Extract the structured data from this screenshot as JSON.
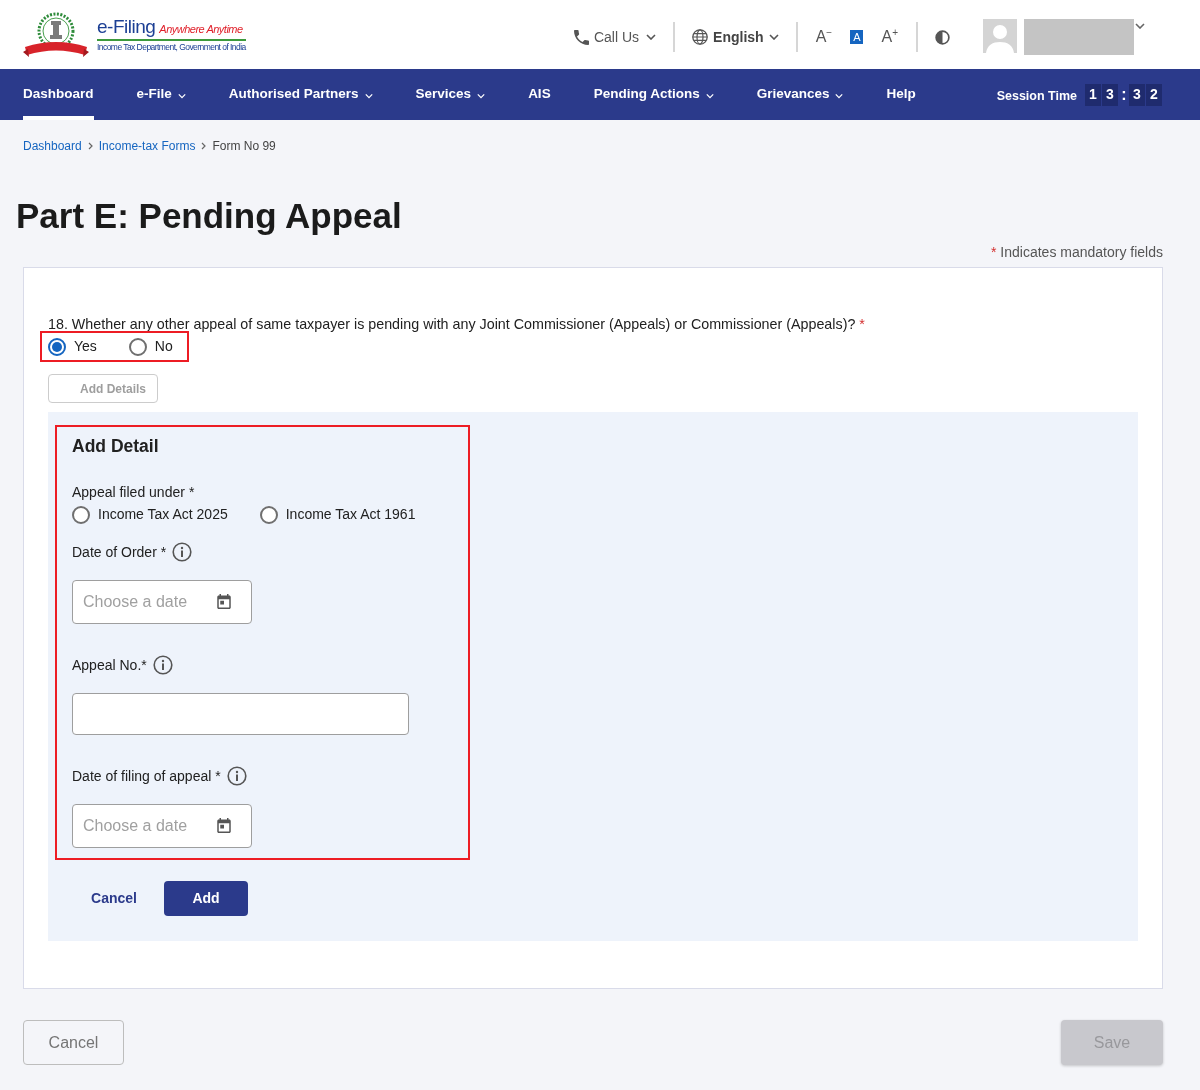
{
  "header": {
    "logo": {
      "title": "e-Filing",
      "tagline": "Anywhere Anytime",
      "subtitle": "Income Tax Department, Government of India"
    },
    "call_us": {
      "label": "Call Us"
    },
    "language": {
      "label": "English"
    },
    "text_size": [
      {
        "label": "A$^{−}$",
        "selected": false
      },
      {
        "label": "A",
        "selected": true
      },
      {
        "label": "A$^{+}$",
        "selected": false
      }
    ]
  },
  "nav": {
    "items": [
      {
        "label": "Dashboard",
        "selected": true,
        "dropdown": false
      },
      {
        "label": "e-File",
        "selected": false,
        "dropdown": true
      },
      {
        "label": "Authorised Partners",
        "selected": false,
        "dropdown": true
      },
      {
        "label": "Services",
        "selected": false,
        "dropdown": true
      },
      {
        "label": "AIS",
        "selected": false,
        "dropdown": false
      },
      {
        "label": "Pending Actions",
        "selected": false,
        "dropdown": true
      },
      {
        "label": "Grievances",
        "selected": false,
        "dropdown": true
      },
      {
        "label": "Help",
        "selected": false,
        "dropdown": false
      }
    ],
    "session_time": {
      "label": "Session Time",
      "minutes": [
        "1",
        "3"
      ],
      "separator": ":",
      "seconds": [
        "3",
        "2"
      ]
    }
  },
  "breadcrumb": [
    {
      "label": "Dashboard",
      "link": true
    },
    {
      "label": "Income-tax Forms",
      "link": true
    },
    {
      "label": "Form No 99",
      "link": false
    }
  ],
  "page_title": "Part E: Pending Appeal",
  "mandatory_note": {
    "mark": "*",
    "text": "Indicates mandatory fields"
  },
  "question": {
    "text": "18. Whether any other appeal of same taxpayer is pending with any Joint Commissioner (Appeals) or Commissioner (Appeals)?",
    "required_mark": "*",
    "highlighted": true,
    "options": [
      {
        "label": "Yes",
        "selected": true
      },
      {
        "label": "No",
        "selected": false
      }
    ]
  },
  "add_details_button": {
    "label": "Add Details",
    "disabled": true
  },
  "detail_panel": {
    "title": "Add Detail",
    "highlighted": true,
    "fields": [
      {
        "kind": "radio",
        "label": "Appeal filed under",
        "required_mark": "*",
        "info": false,
        "options": [
          {
            "label": "Income Tax Act 2025",
            "selected": false
          },
          {
            "label": "Income Tax Act 1961",
            "selected": false
          }
        ]
      },
      {
        "kind": "date",
        "label": "Date of Order",
        "required_mark": "*",
        "info": true,
        "placeholder": "Choose a date"
      },
      {
        "kind": "text",
        "label": "Appeal No.",
        "required_mark": "*",
        "info": true
      },
      {
        "kind": "date",
        "label": "Date of filing of appeal",
        "required_mark": "*",
        "info": true,
        "placeholder": "Choose a date"
      }
    ],
    "actions": [
      {
        "kind": "link",
        "label": "Cancel"
      },
      {
        "kind": "primary",
        "label": "Add"
      }
    ]
  },
  "footer_actions": [
    {
      "kind": "outline",
      "label": "Cancel",
      "disabled": false
    },
    {
      "kind": "solid",
      "label": "Save",
      "disabled": true
    }
  ]
}
